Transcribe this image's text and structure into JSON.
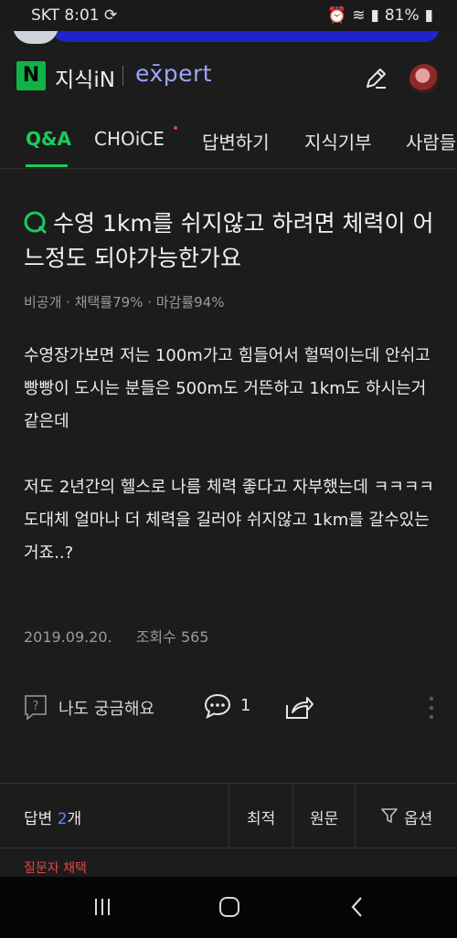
{
  "status_bar": {
    "carrier_time": "SKT 8:01",
    "battery": "81%"
  },
  "header": {
    "logo_letter": "N",
    "brand": "지식iN",
    "expert": "ex̄pert"
  },
  "tabs": [
    {
      "label": "Q&A",
      "active": true
    },
    {
      "label": "CHOiCE",
      "active": false
    },
    {
      "label": "답변하기",
      "active": false
    },
    {
      "label": "지식기부",
      "active": false
    },
    {
      "label": "사람들",
      "active": false
    }
  ],
  "question": {
    "title": "수영 1km를 쉬지않고 하려면 체력이 어느정도 되야가능한가요",
    "meta": "비공개 · 채택률79% · 마감률94%",
    "paragraphs": [
      "수영장가보면 저는 100m가고 힘들어서 헐떡이는데 안쉬고 빵빵이 도시는 분들은 500m도 거뜬하고 1km도 하시는거같은데",
      "",
      "저도 2년간의 헬스로 나름 체력 좋다고 자부했는데 ㅋㅋㅋㅋ",
      "도대체 얼마나 더 체력을 길러야 쉬지않고 1km를 갈수있는거죠..?"
    ],
    "date": "2019.09.20.",
    "views": "조회수 565"
  },
  "actions": {
    "curious_label": "나도 궁금해요",
    "comment_count": "1"
  },
  "answers_bar": {
    "label_prefix": "답변 ",
    "count": "2",
    "label_suffix": "개",
    "sort_latest": "최적",
    "sort_original": "원문",
    "options": "옵션"
  },
  "selected_label": "질문자 채택",
  "colors": {
    "accent_green": "#19cc5a",
    "naver_green": "#10b446",
    "expert_blue": "#9aa5ff",
    "link_blue": "#4a8dff",
    "red": "#e34848"
  }
}
